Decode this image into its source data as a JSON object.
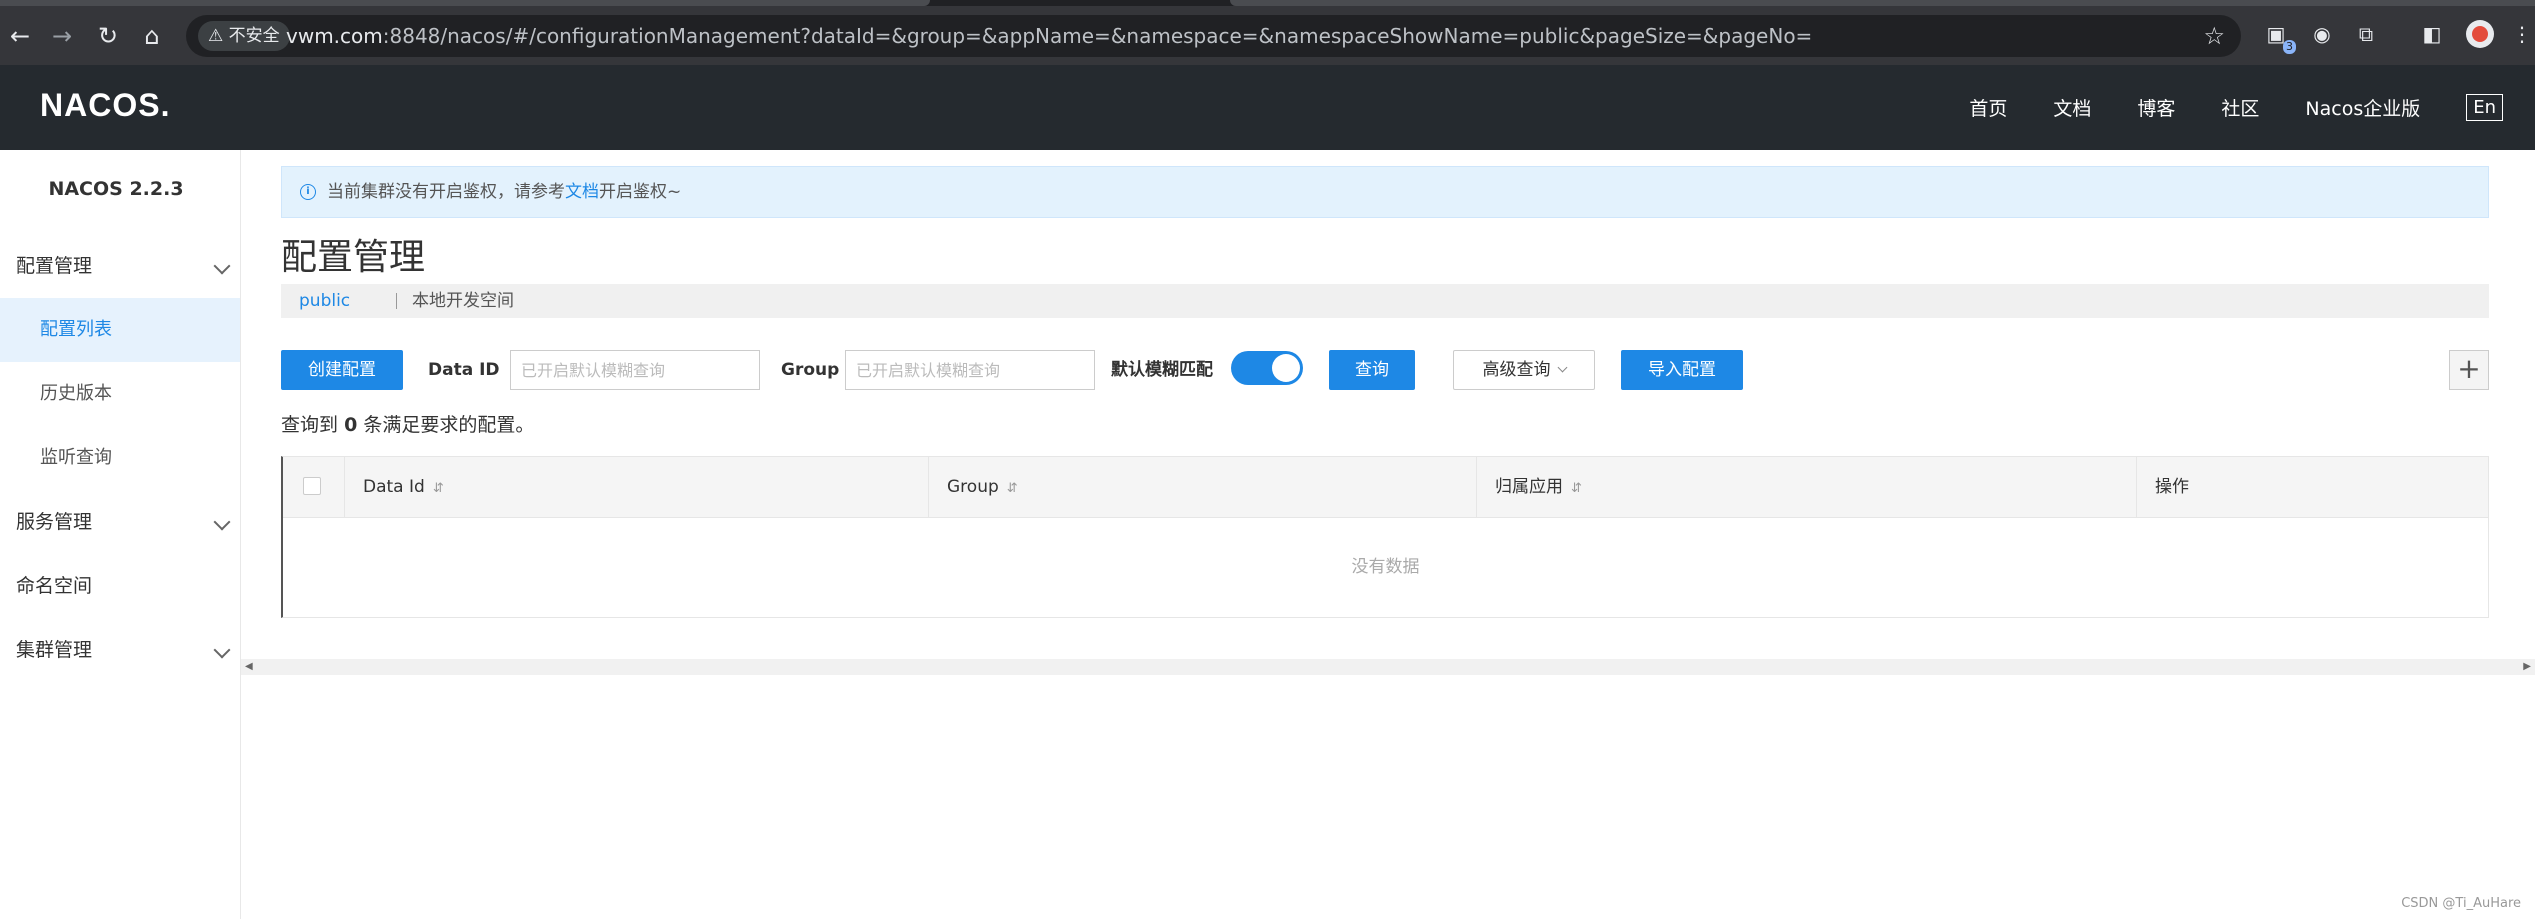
{
  "browser": {
    "security_label": "不安全",
    "url_host": "vwm.com",
    "url_rest": ":8848/nacos/#/configurationManagement?dataId=&group=&appName=&namespace=&namespaceShowName=public&pageSize=&pageNo=",
    "ext_badge": "3"
  },
  "header": {
    "logo": "NACOS.",
    "menu": [
      "首页",
      "文档",
      "博客",
      "社区",
      "Nacos企业版"
    ],
    "lang": "En"
  },
  "sidebar": {
    "version": "NACOS 2.2.3",
    "groups": {
      "config": "配置管理",
      "service": "服务管理",
      "namespace": "命名空间",
      "cluster": "集群管理"
    },
    "config_items": [
      "配置列表",
      "历史版本",
      "监听查询"
    ]
  },
  "alert": {
    "text_before": "当前集群没有开启鉴权，请参考",
    "link": "文档",
    "text_after": "开启鉴权~"
  },
  "page": {
    "title": "配置管理",
    "namespace": "public",
    "namespace_desc": "本地开发空间"
  },
  "toolbar": {
    "create_label": "创建配置",
    "dataid_label": "Data ID",
    "dataid_placeholder": "已开启默认模糊查询",
    "group_label": "Group",
    "group_placeholder": "已开启默认模糊查询",
    "fuzzy_label": "默认模糊匹配",
    "fuzzy_on": true,
    "query_label": "查询",
    "advanced_label": "高级查询",
    "import_label": "导入配置",
    "plus_label": "+"
  },
  "result": {
    "prefix": "查询到",
    "count": "0",
    "suffix": "条满足要求的配置。"
  },
  "table": {
    "columns": [
      "Data Id",
      "Group",
      "归属应用",
      "操作"
    ],
    "empty_text": "没有数据"
  },
  "watermark": "CSDN @Ti_AuHare",
  "colors": {
    "primary": "#1e88e5",
    "header_bg": "#252a2f",
    "active_bg": "#e6f2fd"
  }
}
